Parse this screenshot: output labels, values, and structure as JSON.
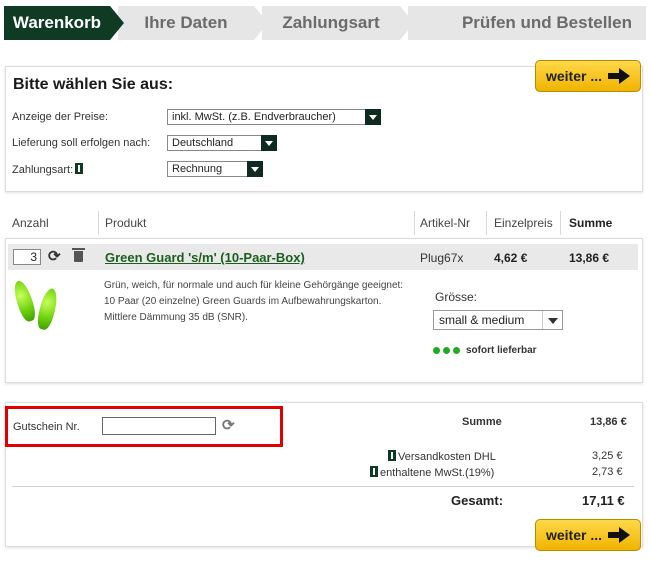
{
  "steps": [
    "Warenkorb",
    "Ihre Daten",
    "Zahlungsart",
    "Prüfen und Bestellen"
  ],
  "options": {
    "heading": "Bitte wählen Sie aus:",
    "weiter": "weiter ...",
    "price_label": "Anzeige der Preise:",
    "price_value": "inkl. MwSt. (z.B. Endverbraucher)",
    "delivery_label": "Lieferung soll erfolgen nach:",
    "delivery_value": "Deutschland",
    "payment_label": "Zahlungsart:",
    "payment_value": "Rechnung"
  },
  "table": {
    "headers": [
      "Anzahl",
      "Produkt",
      "Artikel-Nr",
      "Einzelpreis",
      "Summe"
    ],
    "item": {
      "qty": "3",
      "name": "Green Guard 's/m' (10-Paar-Box)",
      "article": "Plug67x",
      "unit_price": "4,62 €",
      "total": "13,86 €",
      "desc1": "Grün, weich, für normale und auch für kleine Gehörgänge geeignet:",
      "desc2": "10 Paar (20 einzelne) Green Guards im Aufbewahrungskarton.",
      "desc3": "Mittlere Dämmung 35 dB (SNR).",
      "size_label": "Grösse:",
      "size_value": "small & medium",
      "availability": "sofort lieferbar"
    }
  },
  "summary": {
    "voucher_label": "Gutschein Nr.",
    "summe_label": "Summe",
    "summe_value": "13,86 €",
    "shipping_label": "Versandkosten DHL",
    "shipping_value": "3,25 €",
    "vat_label": "enthaltene MwSt.(19%)",
    "vat_value": "2,73 €",
    "total_label": "Gesamt:",
    "total_value": "17,11 €",
    "weiter": "weiter ..."
  },
  "colors": {
    "brand_dark": "#0f3b25",
    "button_yellow": "#f5c518",
    "highlight_red": "#e00000",
    "product_green": "#1b5e20"
  }
}
